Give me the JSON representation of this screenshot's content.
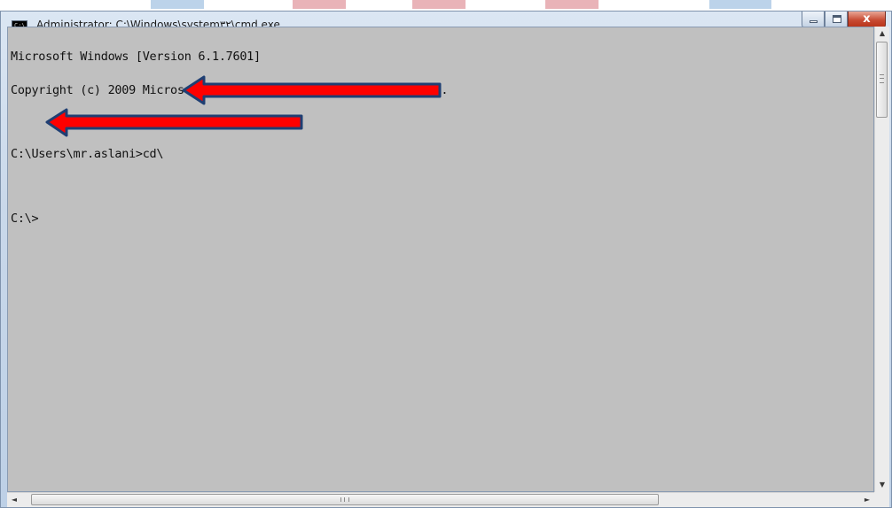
{
  "window": {
    "title": "Administrator: C:\\Windows\\system۳۲\\cmd.exe",
    "icon": "cmd-icon",
    "icon_text": "C:\\"
  },
  "buttons": {
    "minimize": "minimize-icon",
    "maximize": "maximize-icon",
    "close_label": "x"
  },
  "console": {
    "lines": [
      "Microsoft Windows [Version 6.1.7601]",
      "Copyright (c) 2009 Microsoft Corporation.  All rights reserved.",
      "",
      "C:\\Users\\mr.aslani>cd\\",
      "",
      "C:\\>"
    ],
    "background": "#c0c0c0",
    "text_color": "#111111"
  },
  "annotations": {
    "arrow_color": "#ff0000",
    "arrow_outline": "#1f3f73"
  }
}
